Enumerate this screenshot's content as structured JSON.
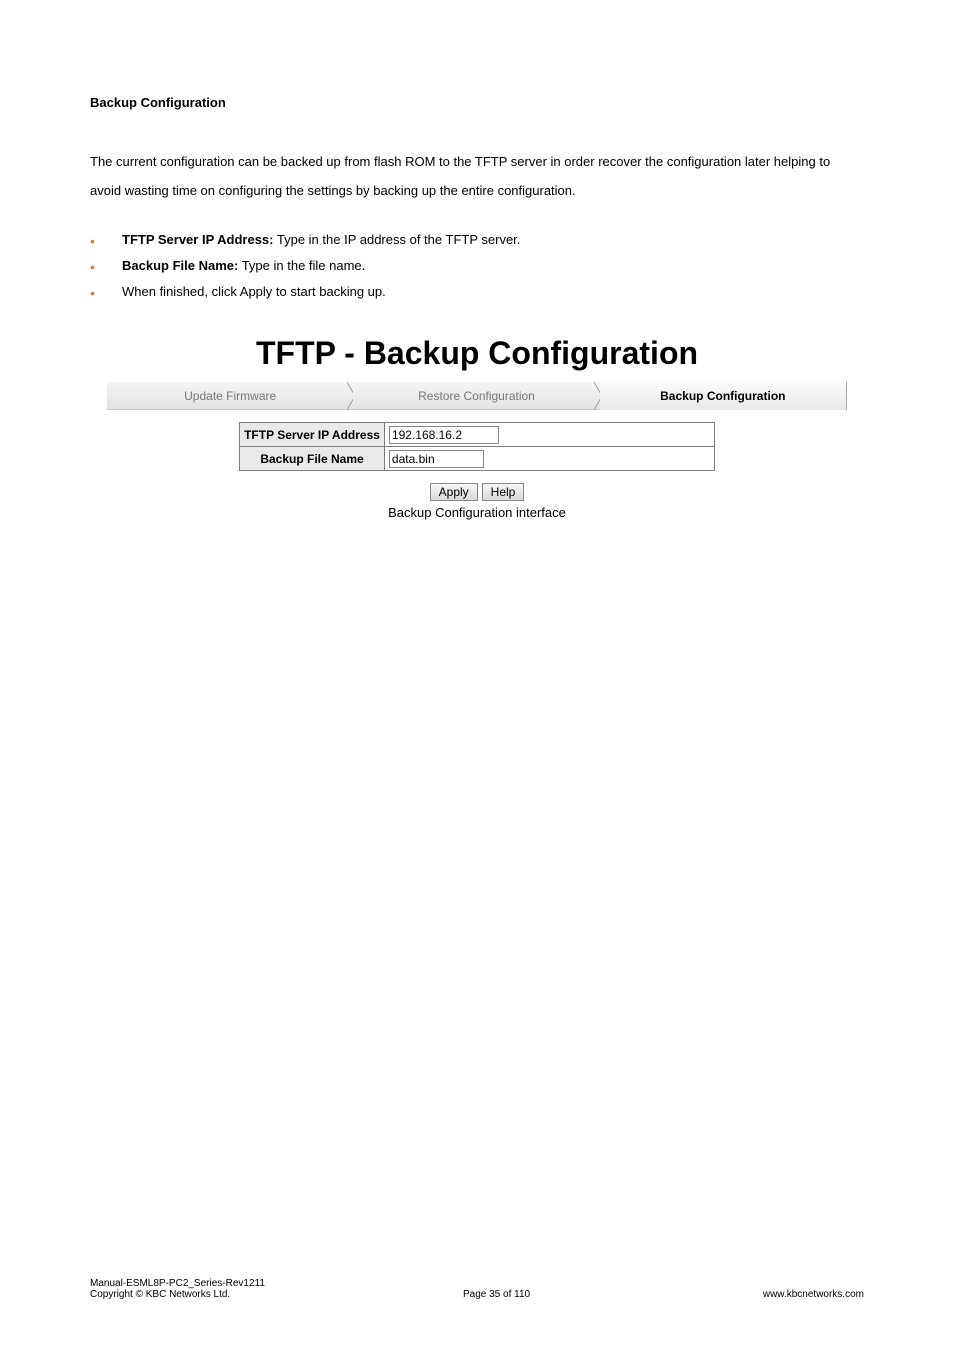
{
  "section": {
    "heading": "Backup Configuration"
  },
  "paragraph": "The current configuration can be backed up from flash ROM to the TFTP server in order recover the configuration later helping to avoid wasting time on configuring the settings by backing up the entire configuration.",
  "bullets": {
    "b1": {
      "label": "TFTP Server IP Address:",
      "text": " Type in the IP address of the TFTP server."
    },
    "b2": {
      "label": "Backup File Name:",
      "text": " Type in the file name."
    },
    "b3": {
      "text": "When finished, click Apply to start backing up."
    }
  },
  "figure": {
    "title": "TFTP - Backup Configuration",
    "tabs": {
      "t1": "Update Firmware",
      "t2": "Restore Configuration",
      "t3": "Backup Configuration"
    },
    "form": {
      "row1_label": "TFTP Server IP Address",
      "row1_value": "192.168.16.2",
      "row2_label": "Backup File Name",
      "row2_value": "data.bin"
    },
    "buttons": {
      "apply": "Apply",
      "help": "Help"
    },
    "caption": "Backup Configuration interface"
  },
  "footer": {
    "l1": "Manual-ESML8P-PC2_Series-Rev1211",
    "l2_left": "Copyright © KBC Networks Ltd.",
    "l2_mid": "Page 35 of 110",
    "l2_right": "www.kbcnetworks.com"
  }
}
